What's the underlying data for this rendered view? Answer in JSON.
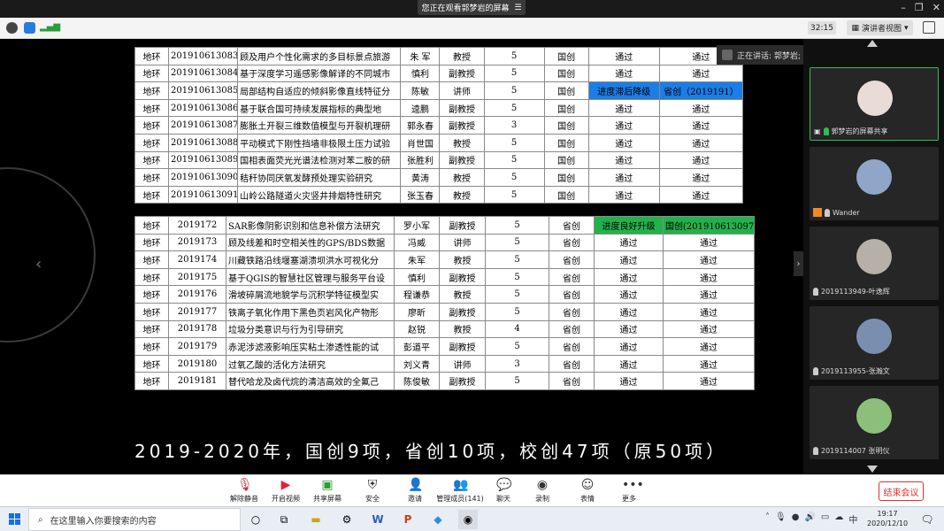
{
  "top": {
    "banner": "您正在观看郭梦岩的屏幕",
    "timer": "32:15",
    "view_mode": "演讲者视图"
  },
  "table1": [
    [
      "地环",
      "201910613083",
      "顾及用户个性化需求的多目标景点旅游",
      "朱 军",
      "教授",
      "5",
      "国创",
      "通过",
      "通过"
    ],
    [
      "地环",
      "201910613084",
      "基于深度学习遥感影像解译的不同城市",
      "慎利",
      "副教授",
      "5",
      "国创",
      "通过",
      "通过"
    ],
    [
      "地环",
      "201910613085",
      "局部结构自适应的倾斜影像直线特征分",
      "陈敏",
      "讲师",
      "5",
      "国创",
      "进度滞后降级",
      "省创（2019191）"
    ],
    [
      "地环",
      "201910613086",
      "基于联合国可持续发展指标的典型地",
      "逵鹏",
      "副教授",
      "5",
      "国创",
      "通过",
      "通过"
    ],
    [
      "地环",
      "201910613087",
      "膨胀土开裂三维数值模型与开裂机理研",
      "郭永春",
      "副教授",
      "3",
      "国创",
      "通过",
      "通过"
    ],
    [
      "地环",
      "201910613088",
      "平动模式下刚性挡墙非极限土压力试验",
      "肖世国",
      "教授",
      "5",
      "国创",
      "通过",
      "通过"
    ],
    [
      "地环",
      "201910613089",
      "国相表面荧光光谱法检测对苯二胺的研",
      "张胜利",
      "副教授",
      "5",
      "国创",
      "通过",
      "通过"
    ],
    [
      "地环",
      "201910613090",
      "秸秆协同厌氧发酵预处理实验研究",
      "黄涛",
      "教授",
      "5",
      "国创",
      "通过",
      "通过"
    ],
    [
      "地环",
      "201910613091",
      "山岭公路隧道火灾竖井排烟特性研究",
      "张玉春",
      "教授",
      "5",
      "国创",
      "通过",
      "通过"
    ]
  ],
  "table2": [
    [
      "地环",
      "2019172",
      "SAR影像阴影识别和信息补偿方法研究",
      "罗小军",
      "副教授",
      "5",
      "省创",
      "进度良好升级",
      "国创(201910613097)"
    ],
    [
      "地环",
      "2019173",
      "顾及线差和时空相关性的GPS/BDS数据",
      "冯威",
      "讲师",
      "5",
      "省创",
      "通过",
      "通过"
    ],
    [
      "地环",
      "2019174",
      "川藏铁路沿线堰塞湖溃坝洪水可视化分",
      "朱军",
      "教授",
      "5",
      "省创",
      "通过",
      "通过"
    ],
    [
      "地环",
      "2019175",
      "基于QGIS的智慧社区管理与服务平台设",
      "慎利",
      "副教授",
      "5",
      "省创",
      "通过",
      "通过"
    ],
    [
      "地环",
      "2019176",
      "滑坡碎屑流地貌学与沉积学特征模型实",
      "程谦恭",
      "教授",
      "5",
      "省创",
      "通过",
      "通过"
    ],
    [
      "地环",
      "2019177",
      "铁离子氧化作用下黑色页岩风化产物形",
      "廖昕",
      "副教授",
      "5",
      "省创",
      "通过",
      "通过"
    ],
    [
      "地环",
      "2019178",
      "垃圾分类意识与行为引导研究",
      "赵锐",
      "教授",
      "4",
      "省创",
      "通过",
      "通过"
    ],
    [
      "地环",
      "2019179",
      "赤泥涉滤液影响压实粘土渗透性能的试",
      "彭道平",
      "副教授",
      "5",
      "省创",
      "通过",
      "通过"
    ],
    [
      "地环",
      "2019180",
      "过氧乙酸的活化方法研究",
      "刘义青",
      "讲师",
      "3",
      "省创",
      "通过",
      "通过"
    ],
    [
      "地环",
      "2019181",
      "替代哈龙及卤代烷的清洁高效的全氟己",
      "陈俊敏",
      "副教授",
      "5",
      "省创",
      "通过",
      "通过"
    ]
  ],
  "caption": "2019-2020年，国创9项，省创10项，校创47项（原50项）",
  "speaking": "正在讲话: 郭梦岩;",
  "participants": [
    {
      "name": "郭梦岩的屏幕共享"
    },
    {
      "name": "Wander"
    },
    {
      "name": "2019113949-叶逸辉"
    },
    {
      "name": "2019113955-张瀚文"
    },
    {
      "name": "2019114007 张明仪"
    }
  ],
  "meetbar": [
    {
      "label": "解除静音",
      "icon": "mic-muted-icon"
    },
    {
      "label": "开启视频",
      "icon": "video-off-icon"
    },
    {
      "label": "共享屏幕",
      "icon": "share-screen-icon"
    },
    {
      "label": "安全",
      "icon": "shield-icon"
    },
    {
      "label": "邀请",
      "icon": "invite-icon"
    },
    {
      "label": "管理成员(141)",
      "icon": "members-icon"
    },
    {
      "label": "聊天",
      "icon": "chat-icon"
    },
    {
      "label": "录制",
      "icon": "record-icon"
    },
    {
      "label": "表情",
      "icon": "emoji-icon"
    },
    {
      "label": "更多",
      "icon": "more-icon"
    }
  ],
  "end_meeting": "结束会议",
  "taskbar": {
    "search_placeholder": "在这里输入你要搜索的内容",
    "time": "19:17",
    "date": "2020/12/10",
    "ime": "中"
  },
  "colors": {
    "highlight_blue": "#1a7ee6",
    "highlight_green": "#22b24c",
    "end_red": "#e03030"
  }
}
